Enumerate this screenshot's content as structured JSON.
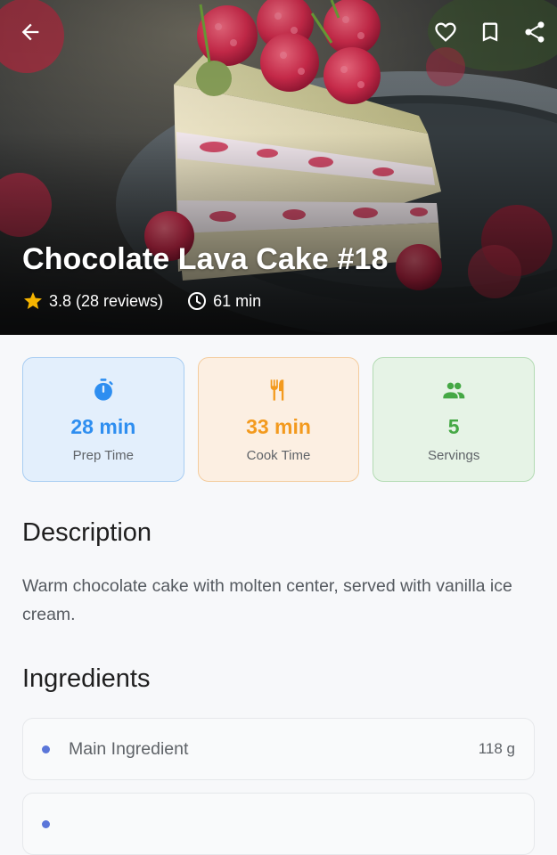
{
  "colors": {
    "prep_accent": "#2e8ef0",
    "cook_accent": "#f39a1e",
    "servings_accent": "#45a845",
    "star": "#f5b400",
    "ingredient_dot": "#5b76d9"
  },
  "header": {
    "icons": [
      "back-arrow-icon",
      "heart-icon",
      "bookmark-icon",
      "share-icon"
    ]
  },
  "hero": {
    "image_description": "Slice of layered cream cake topped with raspberries",
    "title": "Chocolate Lava Cake #18",
    "rating_text": "3.8 (28 reviews)",
    "total_time": "61 min"
  },
  "stats": [
    {
      "icon": "timer-icon",
      "value": "28 min",
      "label": "Prep Time"
    },
    {
      "icon": "utensils-icon",
      "value": "33 min",
      "label": "Cook Time"
    },
    {
      "icon": "people-icon",
      "value": "5",
      "label": "Servings"
    }
  ],
  "description": {
    "title": "Description",
    "text": "Warm chocolate cake with molten center, served with vanilla ice cream."
  },
  "ingredients": {
    "title": "Ingredients",
    "items": [
      {
        "name": "Main Ingredient",
        "quantity": "118 g"
      },
      {
        "name": "",
        "quantity": ""
      }
    ]
  }
}
